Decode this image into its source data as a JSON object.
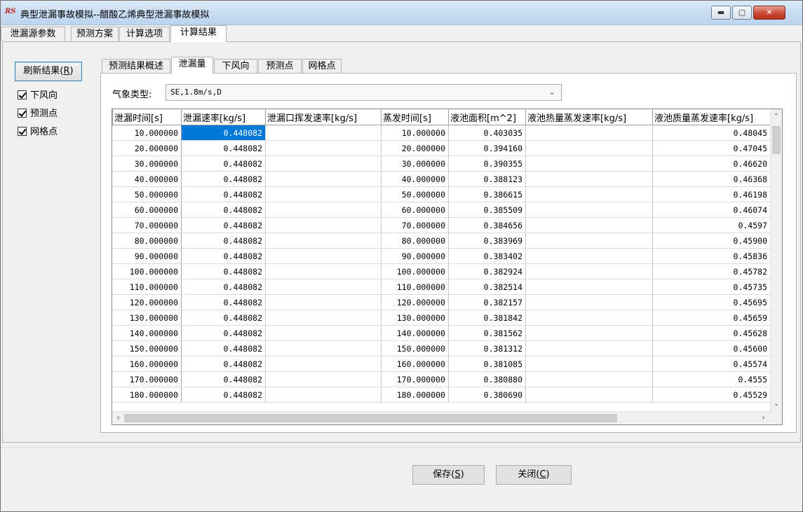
{
  "window": {
    "app_icon_text": "RS",
    "title": "典型泄漏事故模拟--醋酸乙烯典型泄漏事故模拟",
    "minimize_label": "▬",
    "maximize_label": "▢",
    "close_label": "✕"
  },
  "top_tabs": [
    {
      "label": "泄漏源参数"
    },
    {
      "label": "预测方案"
    },
    {
      "label": "计算选项"
    },
    {
      "label": "计算结果",
      "active": true
    }
  ],
  "left_panel": {
    "refresh_button": {
      "label": "刷新结果(",
      "key": "R",
      "suffix": ")"
    },
    "checkboxes": [
      {
        "label": "下风向",
        "checked": true
      },
      {
        "label": "预测点",
        "checked": true
      },
      {
        "label": "网格点",
        "checked": true
      }
    ]
  },
  "sub_tabs": [
    {
      "label": "预测结果概述"
    },
    {
      "label": "泄漏量",
      "active": true
    },
    {
      "label": "下风向"
    },
    {
      "label": "预测点"
    },
    {
      "label": "网格点"
    }
  ],
  "weather": {
    "label": "气象类型:",
    "selected": "SE,1.8m/s,D"
  },
  "table": {
    "columns": [
      "泄漏时间[s]",
      "泄漏速率[kg/s]",
      "泄漏口挥发速率[kg/s]",
      "蒸发时间[s]",
      "液池面积[m^2]",
      "液池热量蒸发速率[kg/s]",
      "液池质量蒸发速率[kg/s]"
    ],
    "selected_cell": {
      "row": 0,
      "col": 1
    },
    "rows": [
      [
        "10.000000",
        "0.448082",
        "",
        "10.000000",
        "0.403035",
        "",
        "0.48045"
      ],
      [
        "20.000000",
        "0.448082",
        "",
        "20.000000",
        "0.394160",
        "",
        "0.47045"
      ],
      [
        "30.000000",
        "0.448082",
        "",
        "30.000000",
        "0.390355",
        "",
        "0.46620"
      ],
      [
        "40.000000",
        "0.448082",
        "",
        "40.000000",
        "0.388123",
        "",
        "0.46368"
      ],
      [
        "50.000000",
        "0.448082",
        "",
        "50.000000",
        "0.386615",
        "",
        "0.46198"
      ],
      [
        "60.000000",
        "0.448082",
        "",
        "60.000000",
        "0.385509",
        "",
        "0.46074"
      ],
      [
        "70.000000",
        "0.448082",
        "",
        "70.000000",
        "0.384656",
        "",
        "0.4597"
      ],
      [
        "80.000000",
        "0.448082",
        "",
        "80.000000",
        "0.383969",
        "",
        "0.45900"
      ],
      [
        "90.000000",
        "0.448082",
        "",
        "90.000000",
        "0.383402",
        "",
        "0.45836"
      ],
      [
        "100.000000",
        "0.448082",
        "",
        "100.000000",
        "0.382924",
        "",
        "0.45782"
      ],
      [
        "110.000000",
        "0.448082",
        "",
        "110.000000",
        "0.382514",
        "",
        "0.45735"
      ],
      [
        "120.000000",
        "0.448082",
        "",
        "120.000000",
        "0.382157",
        "",
        "0.45695"
      ],
      [
        "130.000000",
        "0.448082",
        "",
        "130.000000",
        "0.381842",
        "",
        "0.45659"
      ],
      [
        "140.000000",
        "0.448082",
        "",
        "140.000000",
        "0.381562",
        "",
        "0.45628"
      ],
      [
        "150.000000",
        "0.448082",
        "",
        "150.000000",
        "0.381312",
        "",
        "0.45600"
      ],
      [
        "160.000000",
        "0.448082",
        "",
        "160.000000",
        "0.381085",
        "",
        "0.45574"
      ],
      [
        "170.000000",
        "0.448082",
        "",
        "170.000000",
        "0.380880",
        "",
        "0.4555"
      ],
      [
        "180.000000",
        "0.448082",
        "",
        "180.000000",
        "0.380690",
        "",
        "0.45529"
      ]
    ]
  },
  "footer": {
    "save_button": {
      "label": "保存(",
      "key": "S",
      "suffix": ")"
    },
    "close_button": {
      "label": "关闭(",
      "key": "C",
      "suffix": ")"
    }
  },
  "colors": {
    "selection": "#0078d7",
    "title_gradient_top": "#dbe9f7",
    "close_button": "#c94a35"
  }
}
